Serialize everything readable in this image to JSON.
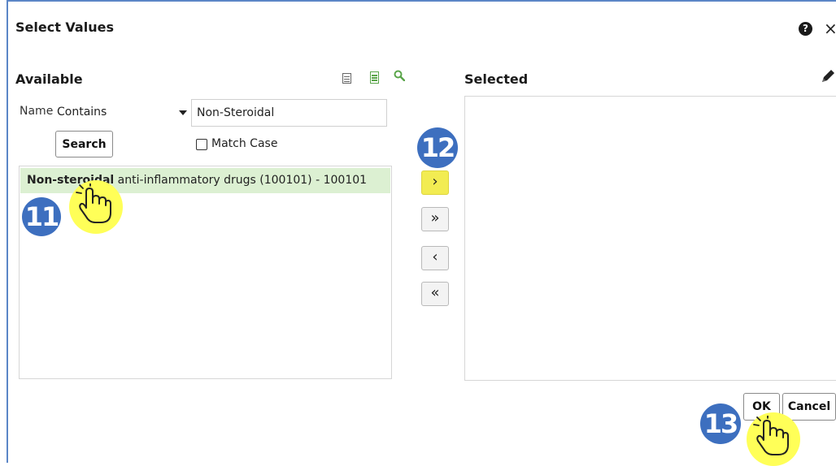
{
  "dialog": {
    "title": "Select Values",
    "help_icon": "help-icon",
    "close_glyph": "×"
  },
  "available": {
    "heading": "Available",
    "toolbar_icons": [
      "list-view-icon",
      "detail-list-icon",
      "search-icon"
    ],
    "name_label": "Name",
    "operator": "Contains",
    "search_value": "Non-Steroidal",
    "search_button": "Search",
    "match_case_label": "Match Case",
    "match_case_checked": false,
    "items": [
      {
        "match": "Non-steroidal",
        "rest": " anti-inflammatory drugs (100101) - 100101",
        "highlighted": true
      }
    ]
  },
  "shuttle": {
    "move": "›",
    "move_all": "»",
    "remove": "‹",
    "remove_all": "«"
  },
  "selected": {
    "heading": "Selected",
    "edit_icon": "pencil-icon",
    "items": []
  },
  "footer": {
    "ok": "OK",
    "cancel": "Cancel"
  },
  "annotations": {
    "step_a": "11",
    "step_b": "12",
    "step_c": "13"
  },
  "colors": {
    "accent_blue": "#3d6fbf",
    "highlight_yellow": "#ffff58",
    "row_green": "#dcf0d2",
    "frame_blue": "#5b86c7"
  }
}
